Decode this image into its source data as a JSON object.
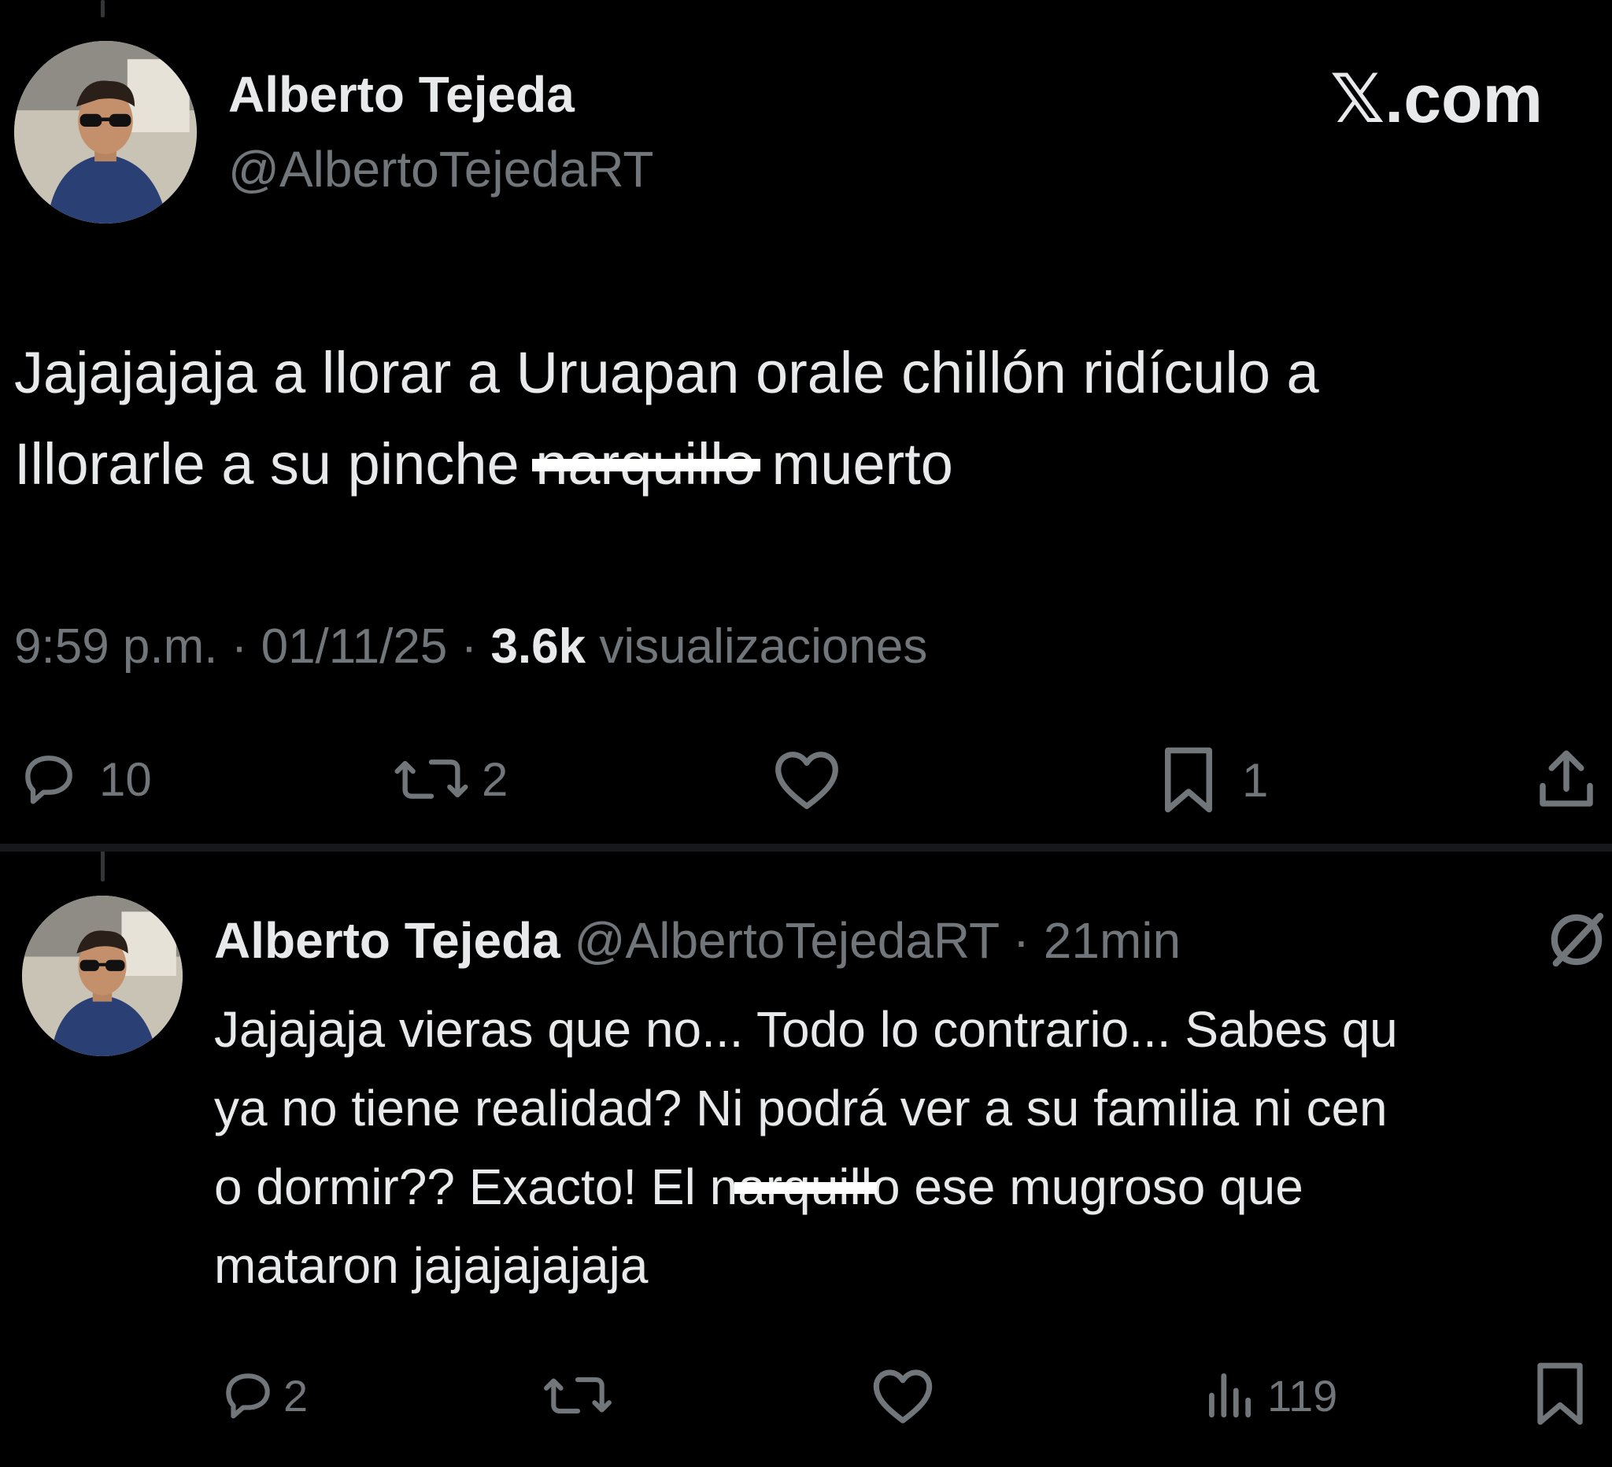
{
  "brand": {
    "x_glyph": "𝕏",
    "domain": ".com"
  },
  "main_tweet": {
    "author_name": "Alberto Tejeda",
    "author_handle": "@AlbertoTejedaRT",
    "text_line1": "Jajajajaja a llorar a Uruapan orale chillón ridículo a",
    "text_line2_before": "Illorarle a su pinche ",
    "text_line2_redacted": "narquillo",
    "text_line2_after": " muerto",
    "time": "9:59 p.m.",
    "sep1": " · ",
    "date": "01/11/25",
    "sep2": " · ",
    "views_count": "3.6k",
    "views_label": " visualizaciones",
    "actions": {
      "reply_icon": "reply-icon",
      "replies": "10",
      "retweet_icon": "retweet-icon",
      "retweets": "2",
      "like_icon": "heart-icon",
      "bookmark_icon": "bookmark-icon",
      "bookmarks": "1",
      "share_icon": "share-icon"
    }
  },
  "reply_tweet": {
    "author_name": "Alberto Tejeda",
    "meta": "@AlbertoTejedaRT · 21min",
    "line1": "Jajajaja vieras que no... Todo lo contrario... Sabes qu",
    "line2": "ya no tiene realidad? Ni podrá ver a su familia ni cen",
    "line3_before": "o dormir?? Exacto! El n",
    "line3_redacted": "arquill",
    "line3_after": "o ese mugroso que",
    "line4": "mataron jajajajajaja",
    "actions": {
      "reply_icon": "reply-icon",
      "replies": "2",
      "retweet_icon": "retweet-icon",
      "like_icon": "heart-icon",
      "views_icon": "views-icon",
      "views": "119",
      "bookmark_icon": "bookmark-icon"
    }
  },
  "colors": {
    "background": "#000000",
    "text": "#e7e9ea",
    "muted": "#71767b",
    "redaction": "#ffffff"
  }
}
